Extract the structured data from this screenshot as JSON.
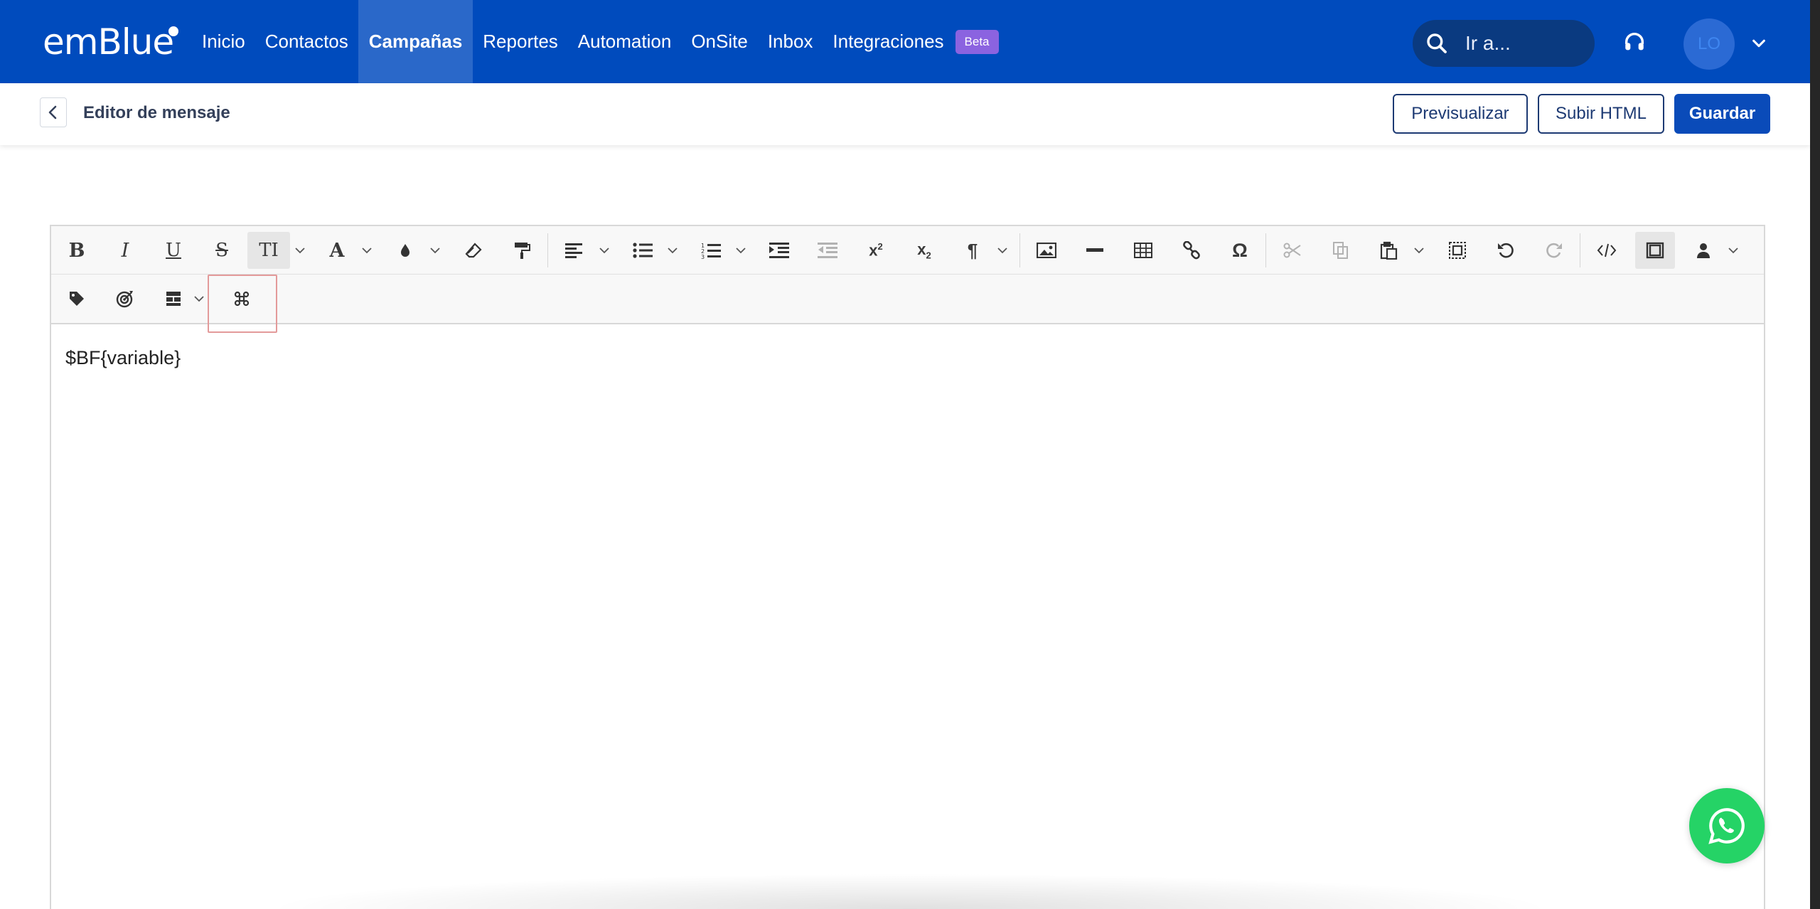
{
  "topnav": {
    "logo": "emBlue",
    "items": [
      {
        "label": "Inicio",
        "active": false
      },
      {
        "label": "Contactos",
        "active": false
      },
      {
        "label": "Campañas",
        "active": true
      },
      {
        "label": "Reportes",
        "active": false
      },
      {
        "label": "Automation",
        "active": false
      },
      {
        "label": "OnSite",
        "active": false
      },
      {
        "label": "Inbox",
        "active": false
      },
      {
        "label": "Integraciones",
        "active": false
      }
    ],
    "beta_badge": "Beta",
    "search_placeholder": "Ir a...",
    "avatar_initials": "LO",
    "brand_color": "#004bbd"
  },
  "subheader": {
    "title": "Editor de mensaje",
    "preview_label": "Previsualizar",
    "upload_html_label": "Subir HTML",
    "save_label": "Guardar"
  },
  "toolbar": {
    "row1": [
      "bold-icon",
      "italic-icon",
      "underline-icon",
      "strikethrough-icon",
      "font-size-icon",
      "font-color-icon",
      "background-color-icon",
      "clear-format-icon",
      "format-painter-icon",
      "align-icon",
      "bullet-list-icon",
      "numbered-list-icon",
      "indent-icon",
      "outdent-icon",
      "superscript-icon",
      "subscript-icon",
      "paragraph-icon",
      "image-icon",
      "horizontal-line-icon",
      "table-icon",
      "link-icon",
      "special-char-icon",
      "cut-icon",
      "copy-icon",
      "paste-icon",
      "select-all-icon",
      "undo-icon",
      "redo-icon",
      "code-view-icon",
      "fullscreen-icon",
      "user-field-icon"
    ],
    "row2": [
      "tag-icon",
      "target-icon",
      "blocks-icon",
      "command-icon"
    ]
  },
  "editor": {
    "content": "$BF{variable}"
  },
  "whatsapp": {
    "color": "#25d366"
  }
}
